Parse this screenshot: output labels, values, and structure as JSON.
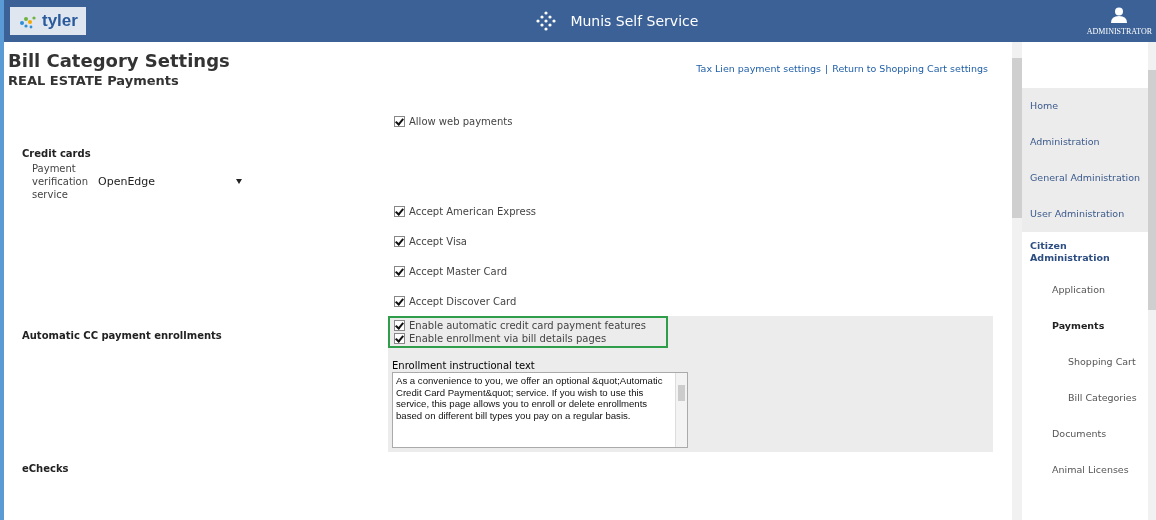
{
  "header": {
    "logo": "tyler",
    "title": "Munis Self Service",
    "user": "ADMINISTRATOR"
  },
  "page": {
    "title": "Bill Category Settings",
    "subtitle": "REAL ESTATE Payments",
    "links": [
      "Tax Lien payment settings",
      "Return to Shopping Cart settings"
    ],
    "link_separator": "|"
  },
  "form": [
    {
      "kind": "checkbox",
      "label": "Allow web payments",
      "checked": true
    },
    {
      "kind": "section",
      "label": "Credit cards"
    },
    {
      "kind": "select",
      "label": "Payment verification service",
      "value": "OpenEdge"
    },
    {
      "kind": "checkbox",
      "label": "Accept American Express",
      "checked": true
    },
    {
      "kind": "checkbox",
      "label": "Accept Visa",
      "checked": true
    },
    {
      "kind": "checkbox",
      "label": "Accept Master Card",
      "checked": true
    },
    {
      "kind": "checkbox",
      "label": "Accept Discover Card",
      "checked": true
    },
    {
      "kind": "group",
      "label": "Automatic CC payment enrollments",
      "options": [
        {
          "label": "Enable automatic credit card payment features",
          "checked": true
        },
        {
          "label": "Enable enrollment via bill details pages",
          "checked": true
        }
      ],
      "textarea_label": "Enrollment instructional text",
      "textarea_value": "As a convenience to you, we offer an optional &quot;Automatic Credit Card Payment&quot; service. If you wish to use this service, this page allows you to enroll or delete enrollments based on different bill types you pay on a regular basis."
    },
    {
      "kind": "section",
      "label": "eChecks"
    }
  ],
  "sidebar": {
    "items": [
      {
        "label": "Home",
        "expanded": false
      },
      {
        "label": "Administration",
        "expanded": false
      },
      {
        "label": "General Administration",
        "expanded": false
      },
      {
        "label": "User Administration",
        "expanded": false
      },
      {
        "label": "Citizen Administration",
        "expanded": true,
        "children": [
          {
            "label": "Application",
            "expanded": false
          },
          {
            "label": "Payments",
            "expanded": true,
            "children": [
              {
                "label": "Shopping Cart",
                "expanded": false
              },
              {
                "label": "Bill Categories",
                "expanded": false
              }
            ]
          },
          {
            "label": "Documents",
            "expanded": false
          },
          {
            "label": "Animal Licenses",
            "expanded": false
          }
        ]
      }
    ]
  }
}
